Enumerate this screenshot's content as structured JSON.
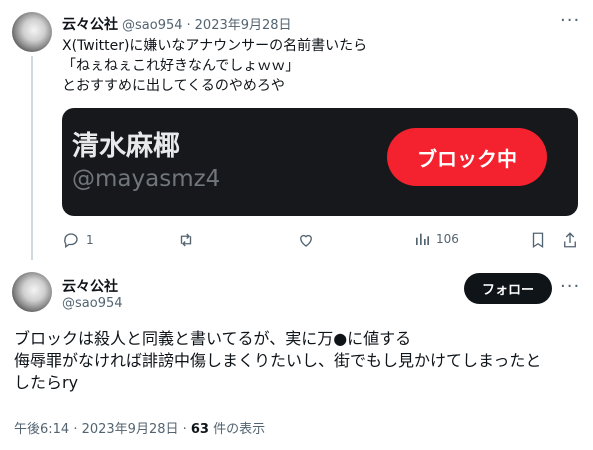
{
  "tweet1": {
    "author_name": "云々公社",
    "handle": "@sao954",
    "separator": "·",
    "date": "2023年9月28日",
    "text": "X(Twitter)に嫌いなアナウンサーの名前書いたら\n「ねぇねぇこれ好きなんでしょｗｗ」\nとおすすめに出してくるのやめろや",
    "card": {
      "name": "清水麻椰",
      "handle": "@mayasmz4",
      "block_button_label": "ブロック中"
    },
    "actions": {
      "reply_count": "1",
      "retweet_count": "",
      "like_count": "",
      "view_count": "106"
    }
  },
  "tweet2": {
    "author_name": "云々公社",
    "handle": "@sao954",
    "follow_label": "フォロー",
    "text_line1": "ブロックは殺人と同義と書いてるが、実に万●に値する",
    "text_line2": "侮辱罪がなければ誹謗中傷しまくりたいし、街でもし見かけてしまったと",
    "text_line3": "したらry",
    "meta_time": "午後6:14 · 2023年9月28日 · ",
    "meta_views": "63",
    "meta_views_suffix": " 件の表示"
  },
  "icons": [
    "more-icon",
    "reply-icon",
    "retweet-icon",
    "like-icon",
    "views-icon",
    "bookmark-icon",
    "share-icon"
  ],
  "colors": {
    "block_red": "#f4212e",
    "card_bg": "#16181c",
    "text": "#0f1419",
    "muted": "#536471"
  }
}
